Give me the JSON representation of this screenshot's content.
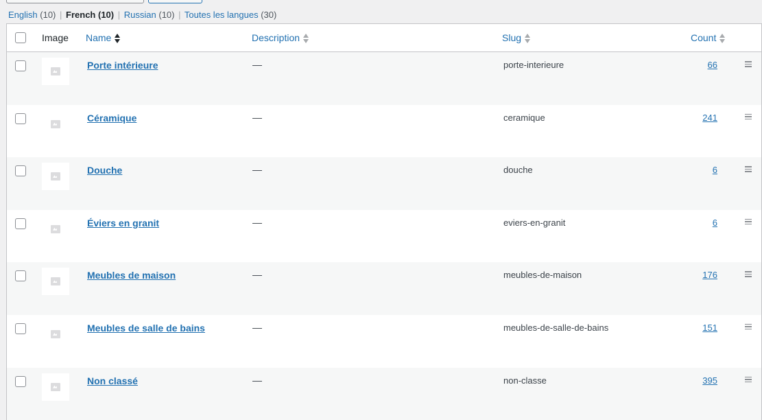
{
  "filters": [
    {
      "label": "English",
      "count": "(10)",
      "current": false
    },
    {
      "label": "French",
      "count": "(10)",
      "current": true
    },
    {
      "label": "Russian",
      "count": "(10)",
      "current": false
    },
    {
      "label": "Toutes les langues",
      "count": "(30)",
      "current": false
    }
  ],
  "separator": "|",
  "columns": {
    "image": "Image",
    "name": "Name",
    "description": "Description",
    "slug": "Slug",
    "count": "Count"
  },
  "rows": [
    {
      "name": "Porte intérieure",
      "description": "—",
      "slug": "porte-interieure",
      "count": "66"
    },
    {
      "name": "Céramique",
      "description": "—",
      "slug": "ceramique",
      "count": "241"
    },
    {
      "name": "Douche",
      "description": "—",
      "slug": "douche",
      "count": "6"
    },
    {
      "name": "Éviers en granit",
      "description": "—",
      "slug": "eviers-en-granit",
      "count": "6"
    },
    {
      "name": "Meubles de maison",
      "description": "—",
      "slug": "meubles-de-maison",
      "count": "176"
    },
    {
      "name": "Meubles de salle de bains",
      "description": "—",
      "slug": "meubles-de-salle-de-bains",
      "count": "151"
    },
    {
      "name": "Non classé",
      "description": "—",
      "slug": "non-classe",
      "count": "395"
    }
  ],
  "icons": {
    "thumbnail": "image-placeholder-icon",
    "drag": "drag-handle-icon",
    "sort": "sort-arrows-icon"
  },
  "colors": {
    "link": "#2271b1",
    "row_alt": "#f6f7f7",
    "border": "#c3c4c7"
  }
}
